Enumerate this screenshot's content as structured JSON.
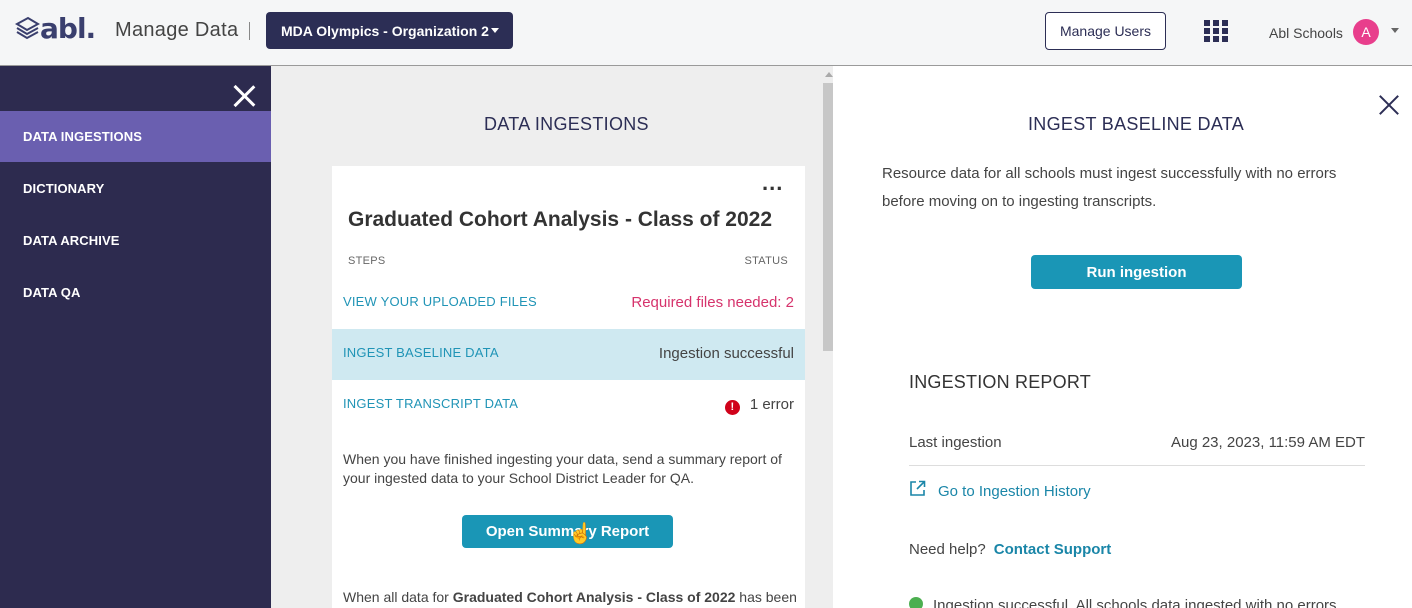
{
  "header": {
    "logo_text": "abl.",
    "app_title": "Manage Data",
    "org_selector": "MDA Olympics - Organization 2",
    "manage_users_label": "Manage Users",
    "user_name": "Abl Schools",
    "avatar_initial": "A"
  },
  "sidebar": {
    "items": [
      {
        "label": "DATA INGESTIONS",
        "active": true
      },
      {
        "label": "DICTIONARY",
        "active": false
      },
      {
        "label": "DATA ARCHIVE",
        "active": false
      },
      {
        "label": "DATA QA",
        "active": false
      }
    ]
  },
  "middle": {
    "title": "DATA INGESTIONS",
    "card": {
      "more_label": "...",
      "title": "Graduated Cohort Analysis - Class of 2022",
      "columns": {
        "steps": "STEPS",
        "status": "STATUS"
      },
      "steps": [
        {
          "label": "VIEW YOUR UPLOADED FILES",
          "status": "Required files needed: 2"
        },
        {
          "label": "INGEST BASELINE DATA",
          "status": "Ingestion successful"
        },
        {
          "label": "INGEST TRANSCRIPT DATA",
          "status": "1 error",
          "error_icon": "!"
        }
      ],
      "info_text": "When you have finished ingesting your data, send a summary report of your ingested data to your School District Leader for QA.",
      "summary_button": "Open Summary Report",
      "bottom_prefix": "When all data for ",
      "bottom_bold": "Graduated Cohort Analysis - Class of 2022",
      "bottom_suffix": " has been"
    }
  },
  "right": {
    "title": "INGEST BASELINE DATA",
    "description": "Resource data for all schools must ingest successfully with no errors before moving on to ingesting transcripts.",
    "run_button": "Run ingestion",
    "report": {
      "title": "INGESTION REPORT",
      "last_label": "Last ingestion",
      "last_value": "Aug 23, 2023, 11:59 AM EDT",
      "history_link": "Go to Ingestion History",
      "help_prefix": "Need help?",
      "help_link": "Contact Support",
      "success_text": "Ingestion successful. All schools data ingested with no errors"
    }
  },
  "colors": {
    "brand_navy": "#2c2e55",
    "sidebar_bg": "#2d2b4f",
    "sidebar_active": "#6a5fb0",
    "accent_teal": "#1a96b6",
    "error_red": "#d0021b",
    "warning_pink": "#d6336c"
  }
}
